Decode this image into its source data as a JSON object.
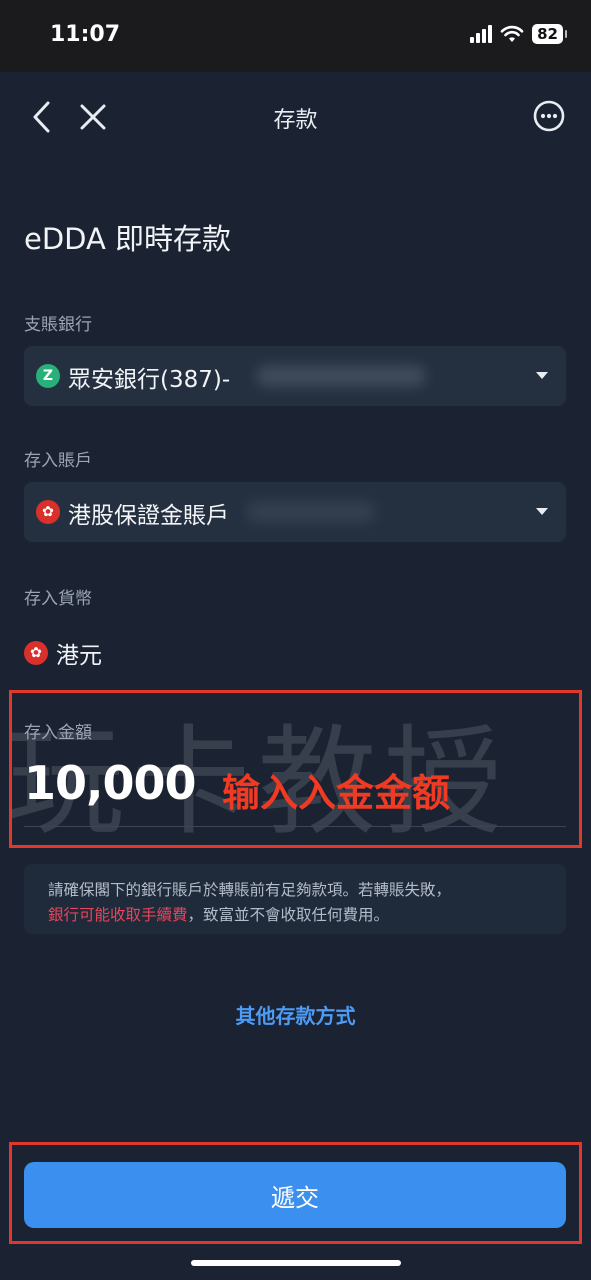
{
  "status": {
    "time": "11:07",
    "battery": "82"
  },
  "nav": {
    "title": "存款",
    "back_icon": "chevron-left-icon",
    "close_icon": "close-icon",
    "more_icon": "more-icon"
  },
  "page": {
    "heading": "eDDA 即時存款"
  },
  "payer_bank": {
    "label": "支賬銀行",
    "value": "眾安銀行(387)-",
    "logo": "Z"
  },
  "deposit_account": {
    "label": "存入賬戶",
    "value": "港股保證金賬戶"
  },
  "currency": {
    "label": "存入貨幣",
    "value": "港元"
  },
  "amount": {
    "label": "存入金額",
    "value": "10,000",
    "annotation": "输入入金金额"
  },
  "watermark": "玩卡教授",
  "notice": {
    "line1": "請確保閣下的銀行賬戶於轉賬前有足夠款項。若轉賬失敗，",
    "line2_highlight": "銀行可能收取手續費",
    "line2_rest": "，致富並不會收取任何費用。"
  },
  "other_methods": "其他存款方式",
  "submit": "遞交",
  "colors": {
    "accent": "#3b8fef",
    "annotation_red": "#e0382b",
    "background": "#1b2332"
  }
}
